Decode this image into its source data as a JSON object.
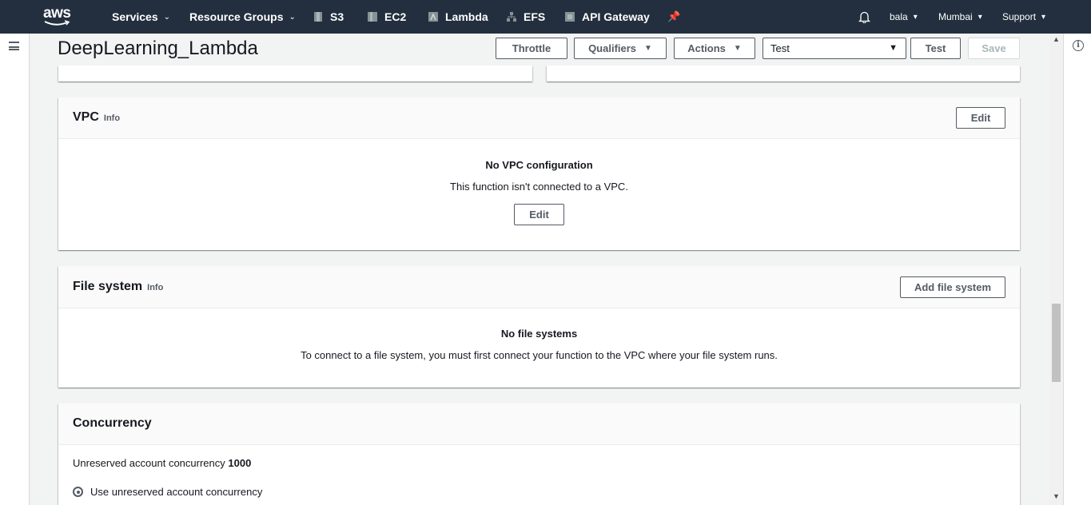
{
  "topnav": {
    "logo_text": "aws",
    "services": "Services",
    "resource_groups": "Resource Groups",
    "shortcuts": [
      {
        "label": "S3",
        "icon": "s3-icon"
      },
      {
        "label": "EC2",
        "icon": "ec2-icon"
      },
      {
        "label": "Lambda",
        "icon": "lambda-icon"
      },
      {
        "label": "EFS",
        "icon": "efs-icon"
      },
      {
        "label": "API Gateway",
        "icon": "api-gateway-icon"
      }
    ],
    "user": "bala",
    "region": "Mumbai",
    "support": "Support"
  },
  "header": {
    "title": "DeepLearning_Lambda",
    "throttle": "Throttle",
    "qualifiers": "Qualifiers",
    "actions": "Actions",
    "test_select_value": "Test",
    "test_button": "Test",
    "save_button": "Save"
  },
  "vpc": {
    "title": "VPC",
    "info": "Info",
    "edit": "Edit",
    "empty_title": "No VPC configuration",
    "empty_text": "This function isn't connected to a VPC.",
    "empty_edit": "Edit"
  },
  "file_system": {
    "title": "File system",
    "info": "Info",
    "add": "Add file system",
    "empty_title": "No file systems",
    "empty_text": "To connect to a file system, you must first connect your function to the VPC where your file system runs."
  },
  "concurrency": {
    "title": "Concurrency",
    "unreserved_label": "Unreserved account concurrency",
    "unreserved_value": "1000",
    "option_unreserved": "Use unreserved account concurrency"
  },
  "colors": {
    "nav_bg": "#232f3e",
    "page_bg": "#f2f3f3",
    "button_border": "#545b64"
  }
}
